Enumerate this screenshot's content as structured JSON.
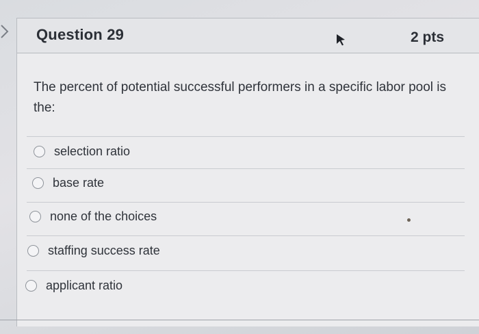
{
  "question": {
    "title": "Question 29",
    "points": "2 pts",
    "text": "The percent of potential successful performers in a specific labor pool is the:"
  },
  "options": [
    {
      "label": "selection ratio",
      "selected": false
    },
    {
      "label": "base rate",
      "selected": false
    },
    {
      "label": "none of the choices",
      "selected": false
    },
    {
      "label": "staffing success rate",
      "selected": false
    },
    {
      "label": "applicant ratio",
      "selected": false
    }
  ],
  "icons": {
    "nav": "chevron-right-icon",
    "cursor": "mouse-cursor-icon",
    "radio": "radio-button-icon"
  },
  "colors": {
    "text": "#2f333a",
    "card_background": "#ececee",
    "header_background": "#e4e5e8",
    "divider": "#c9cbd0"
  }
}
